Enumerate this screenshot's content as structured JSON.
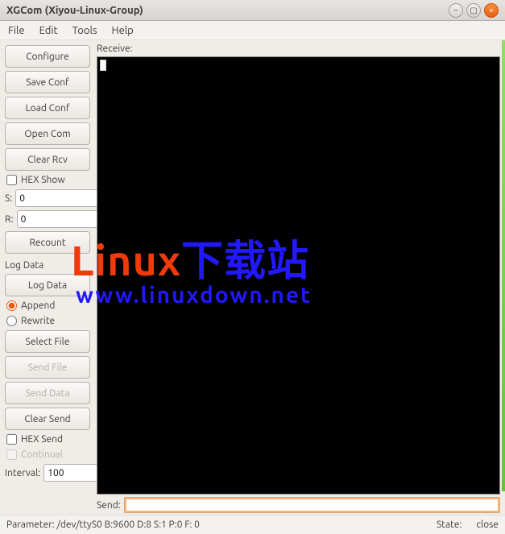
{
  "window": {
    "title": "XGCom (Xiyou-Linux-Group)"
  },
  "menubar": {
    "file": "File",
    "edit": "Edit",
    "tools": "Tools",
    "help": "Help"
  },
  "sidebar": {
    "configure": "Configure",
    "save_conf": "Save Conf",
    "load_conf": "Load Conf",
    "open_com": "Open Com",
    "clear_rcv": "Clear Rcv",
    "hex_show": "HEX Show",
    "s_label": "S:",
    "r_label": "R:",
    "s_value": "0",
    "r_value": "0",
    "recount": "Recount",
    "log_data_label": "Log Data",
    "log_data_btn": "Log Data",
    "append": "Append",
    "rewrite": "Rewrite",
    "select_file": "Select File",
    "send_file": "Send File",
    "send_data": "Send Data",
    "clear_send": "Clear Send",
    "hex_send": "HEX Send",
    "continual": "Continual",
    "interval_label": "Interval:",
    "interval_value": "100"
  },
  "content": {
    "receive_label": "Receive:",
    "send_label": "Send:"
  },
  "watermark": {
    "line1a": "Linux",
    "line1b": "下载站",
    "line2": "www.linuxdown.net"
  },
  "status": {
    "parameter_label": "Parameter:",
    "parameter_value": "/dev/ttyS0 B:9600 D:8 S:1 P:0 F: 0",
    "state_label": "State:",
    "state_value": "close"
  },
  "icons": {
    "iconify": "iconify-icon",
    "maximize": "maximize-icon",
    "close": "close-icon"
  }
}
